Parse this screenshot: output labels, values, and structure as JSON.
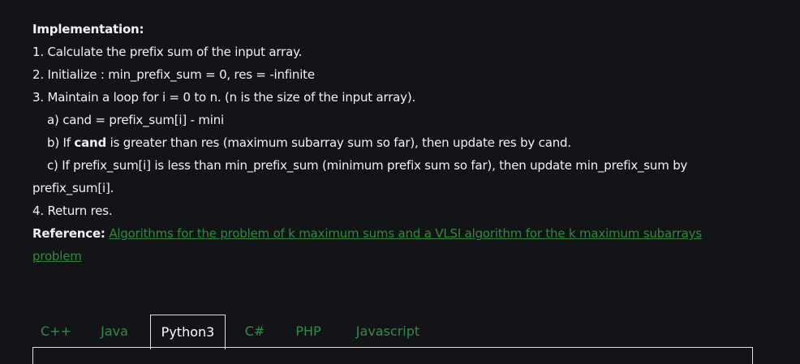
{
  "implementation": {
    "heading": "Implementation:",
    "step1": "1. Calculate the prefix sum of the input array.",
    "step2": "2. Initialize : min_prefix_sum = 0, res = -infinite",
    "step3": "3. Maintain a loop for i = 0 to n. (n is the size of the input array).",
    "step3a": "a) cand = prefix_sum[i] - mini",
    "step3b_pre": "b) If ",
    "step3b_bold": "cand",
    "step3b_post": " is greater than res (maximum subarray sum so far), then update res by cand.",
    "step3c_line1": "c) If prefix_sum[i] is less than min_prefix_sum (minimum prefix sum so far), then update min_prefix_sum by",
    "step3c_line2": "prefix_sum[i].",
    "step4": "4. Return res."
  },
  "reference": {
    "label": "Reference:",
    "link_line1": "Algorithms for the problem of k maximum sums and a VLSI algorithm for the k maximum subarrays",
    "link_line2": "problem"
  },
  "tabs": [
    {
      "label": "C++",
      "active": false
    },
    {
      "label": "Java",
      "active": false
    },
    {
      "label": "Python3",
      "active": true
    },
    {
      "label": "C#",
      "active": false
    },
    {
      "label": "PHP",
      "active": false
    },
    {
      "label": "Javascript",
      "active": false
    }
  ],
  "colors": {
    "background": "#131417",
    "text": "#f2f2f2",
    "link": "#2e8b3d",
    "tab_text": "#2f8d46",
    "active_tab_text": "#ffffff"
  }
}
